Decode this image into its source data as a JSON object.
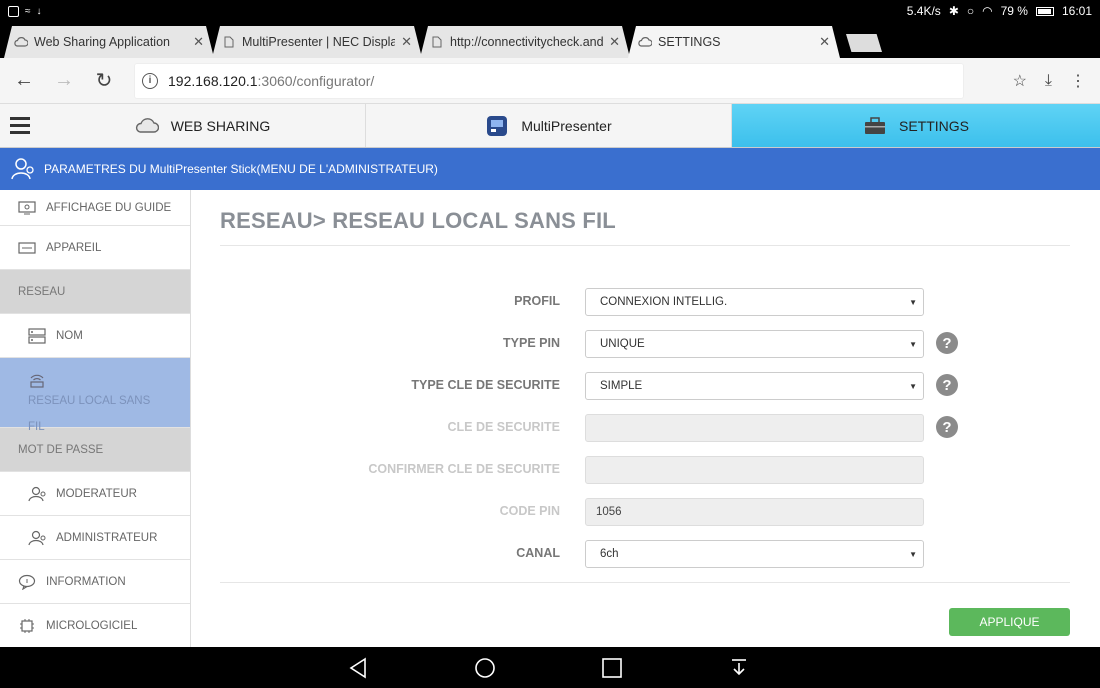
{
  "status_bar": {
    "network_speed": "5.4K/s",
    "battery": "79 %",
    "time": "16:01"
  },
  "browser": {
    "tabs": [
      {
        "label": "Web Sharing Application",
        "icon": "cloud-icon",
        "active": false
      },
      {
        "label": "MultiPresenter | NEC Display",
        "icon": "page-icon",
        "active": false
      },
      {
        "label": "http://connectivitycheck.and",
        "icon": "page-icon",
        "active": false
      },
      {
        "label": "SETTINGS",
        "icon": "cloud-icon",
        "active": true
      }
    ],
    "url_host": "192.168.120.1",
    "url_path": ":3060/configurator/"
  },
  "app_nav": {
    "tabs": [
      {
        "label": "WEB SHARING",
        "icon": "cloud-icon"
      },
      {
        "label": "MultiPresenter",
        "icon": "multipresenter-icon"
      },
      {
        "label": "SETTINGS",
        "icon": "toolbox-icon"
      }
    ],
    "active_tab": "SETTINGS"
  },
  "banner": {
    "text": "PARAMETRES DU MultiPresenter Stick(MENU DE L'ADMINISTRATEUR)"
  },
  "sidebar": {
    "items": [
      {
        "label": "AFFICHAGE DU GUIDE",
        "type": "item",
        "icon": "display-icon"
      },
      {
        "label": "APPAREIL",
        "type": "item",
        "icon": "device-icon"
      },
      {
        "label": "RESEAU",
        "type": "section"
      },
      {
        "label": "NOM",
        "type": "sub",
        "icon": "network-icon"
      },
      {
        "label": "RESEAU LOCAL SANS FIL",
        "type": "sub-selected",
        "icon": "wifi-icon"
      },
      {
        "label": "MOT DE PASSE",
        "type": "section"
      },
      {
        "label": "MODERATEUR",
        "type": "sub",
        "icon": "user-key-icon"
      },
      {
        "label": "ADMINISTRATEUR",
        "type": "sub",
        "icon": "user-key-icon"
      },
      {
        "label": "INFORMATION",
        "type": "item",
        "icon": "info-bubble-icon"
      },
      {
        "label": "MICROLOGICIEL",
        "type": "item",
        "icon": "chip-icon"
      }
    ]
  },
  "main": {
    "title": "RESEAU> RESEAU LOCAL SANS FIL",
    "fields": [
      {
        "label": "PROFIL",
        "value": "CONNEXION INTELLIG.",
        "kind": "select",
        "help": false,
        "enabled": true
      },
      {
        "label": "TYPE PIN",
        "value": "UNIQUE",
        "kind": "select",
        "help": true,
        "enabled": true
      },
      {
        "label": "TYPE CLE DE SECURITE",
        "value": "SIMPLE",
        "kind": "select",
        "help": true,
        "enabled": true
      },
      {
        "label": "CLE DE SECURITE",
        "value": "",
        "kind": "input",
        "help": true,
        "enabled": false
      },
      {
        "label": "CONFIRMER CLE DE SECURITE",
        "value": "",
        "kind": "input",
        "help": false,
        "enabled": false
      },
      {
        "label": "CODE PIN",
        "value": "1056",
        "kind": "input",
        "help": false,
        "enabled": false
      },
      {
        "label": "CANAL",
        "value": "6ch",
        "kind": "select",
        "help": false,
        "enabled": true
      }
    ],
    "apply_label": "APPLIQUE"
  },
  "colors": {
    "banner": "#3a6fcf",
    "active_tab": "#3cc0ec",
    "sidebar_selected": "#9fb9e4",
    "sidebar_section": "#d5d5d5",
    "apply_button": "#5cb85c"
  }
}
